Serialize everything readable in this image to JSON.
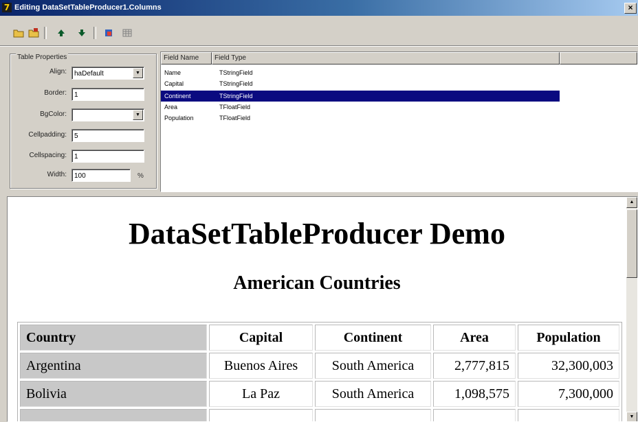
{
  "window": {
    "title": "Editing DataSetTableProducer1.Columns",
    "close_glyph": "×"
  },
  "toolbar": {
    "icons": [
      "open-folder-icon",
      "save-folder-icon",
      "move-up-icon",
      "move-down-icon",
      "add-fields-icon",
      "grid-icon"
    ]
  },
  "table_properties": {
    "title": "Table Properties",
    "align_label": "Align:",
    "align_value": "haDefault",
    "border_label": "Border:",
    "border_value": "1",
    "bgcolor_label": "BgColor:",
    "bgcolor_value": "",
    "cellpadding_label": "Cellpadding:",
    "cellpadding_value": "5",
    "cellspacing_label": "Cellspacing:",
    "cellspacing_value": "1",
    "width_label": "Width:",
    "width_value": "100",
    "width_unit": "%"
  },
  "fields_list": {
    "col_name": "Field Name",
    "col_type": "Field Type",
    "rows": [
      {
        "name": "Name",
        "type": "TStringField"
      },
      {
        "name": "Capital",
        "type": "TStringField"
      },
      {
        "name": "Continent",
        "type": "TStringField"
      },
      {
        "name": "Area",
        "type": "TFloatField"
      },
      {
        "name": "Population",
        "type": "TFloatField"
      }
    ],
    "selected_index": 2
  },
  "preview": {
    "title": "DataSetTableProducer Demo",
    "subtitle": "American Countries",
    "headers": [
      "Country",
      "Capital",
      "Continent",
      "Area",
      "Population"
    ],
    "rows": [
      {
        "country": "Argentina",
        "capital": "Buenos Aires",
        "continent": "South America",
        "area": "2,777,815",
        "population": "32,300,003"
      },
      {
        "country": "Bolivia",
        "capital": "La Paz",
        "continent": "South America",
        "area": "1,098,575",
        "population": "7,300,000"
      }
    ]
  },
  "colors": {
    "selection": "#0a0a80",
    "titlebar": "#0a246a",
    "country_cell": "#c8c8c8"
  }
}
